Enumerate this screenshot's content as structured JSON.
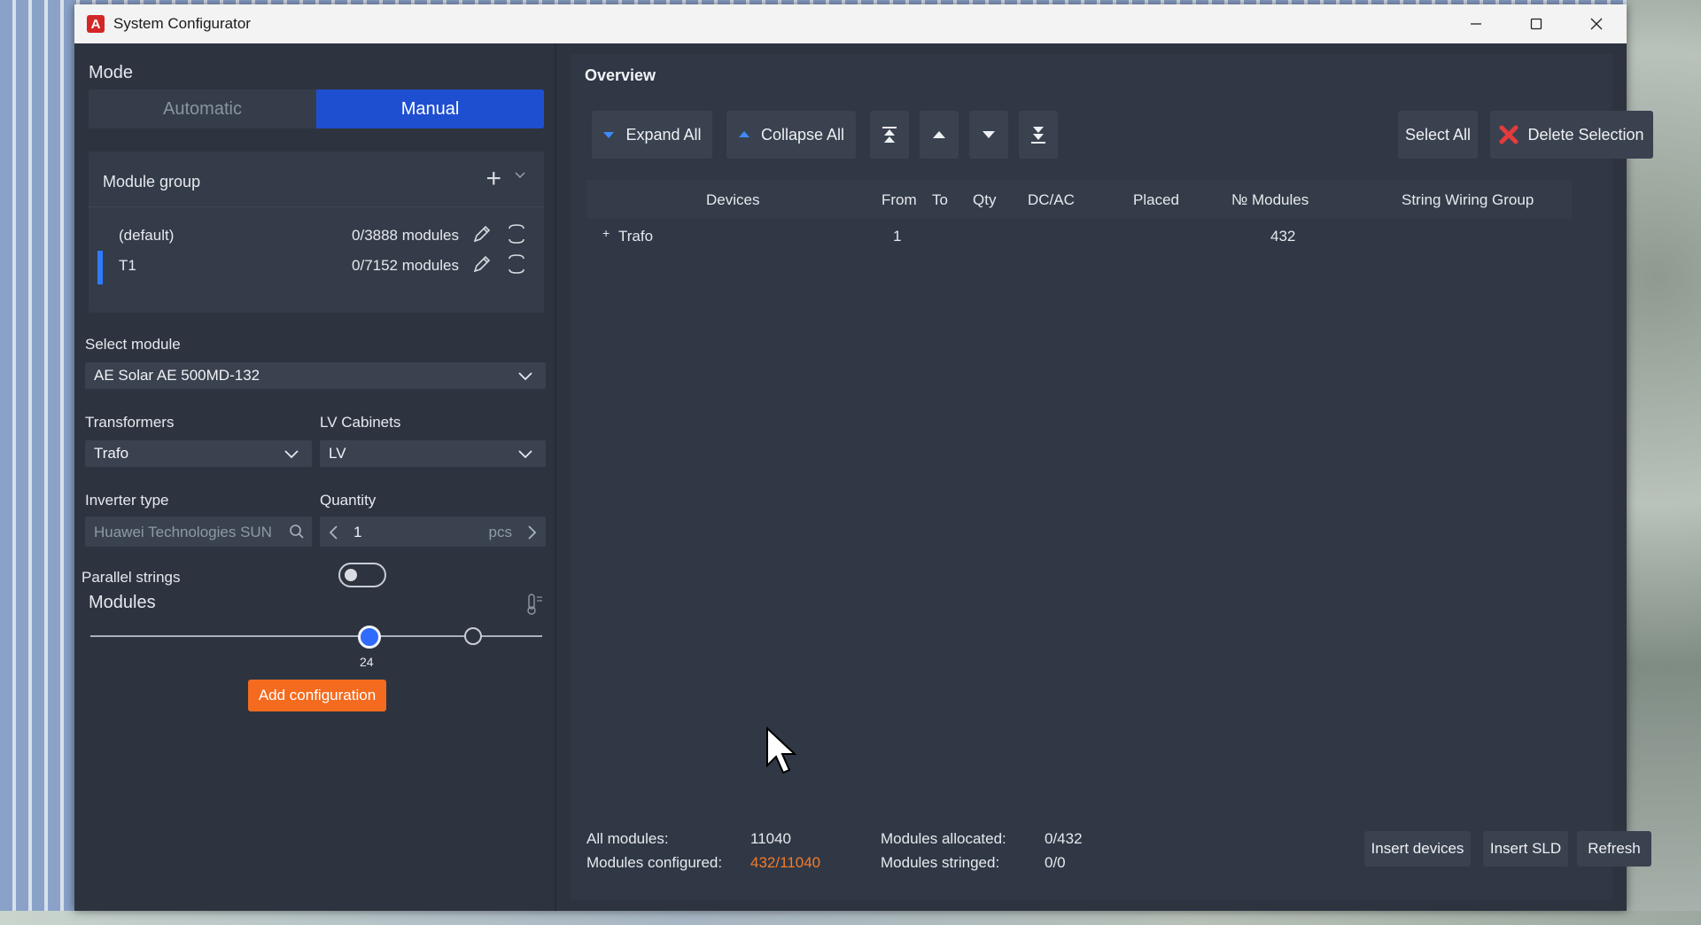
{
  "window": {
    "title": "System Configurator"
  },
  "mode": {
    "title": "Mode",
    "options": [
      "Automatic",
      "Manual"
    ],
    "selected": "Manual"
  },
  "module_group": {
    "title": "Module group",
    "rows": [
      {
        "name": "(default)",
        "count": "0/3888 modules"
      },
      {
        "name": "T1",
        "count": "0/7152 modules"
      }
    ]
  },
  "select_module": {
    "label": "Select module",
    "value": "AE Solar AE 500MD-132"
  },
  "transformers": {
    "label": "Transformers",
    "value": "Trafo"
  },
  "lv_cabinets": {
    "label": "LV Cabinets",
    "value": "LV"
  },
  "inverter_type": {
    "label": "Inverter type",
    "value": "Huawei Technologies SUN"
  },
  "quantity": {
    "label": "Quantity",
    "value": "1",
    "unit": "pcs"
  },
  "parallel_strings": {
    "label": "Parallel strings",
    "enabled": false
  },
  "modules": {
    "label": "Modules",
    "slider_value": "24"
  },
  "add_configuration": "Add configuration",
  "overview": {
    "title": "Overview",
    "toolbar": {
      "expand_all": "Expand All",
      "collapse_all": "Collapse All",
      "select_all": "Select All",
      "delete_selection": "Delete Selection"
    },
    "columns": [
      "Devices",
      "From",
      "To",
      "Qty",
      "DC/AC",
      "Placed",
      "№ Modules",
      "String Wiring Group"
    ],
    "rows": [
      {
        "expander": "+",
        "device": "Trafo",
        "from": "1",
        "modules": "432"
      }
    ],
    "summary": {
      "all_modules_label": "All modules:",
      "all_modules": "11040",
      "modules_configured_label": "Modules configured:",
      "modules_configured": "432/11040",
      "modules_allocated_label": "Modules allocated:",
      "modules_allocated": "0/432",
      "modules_stringed_label": "Modules stringed:",
      "modules_stringed": "0/0"
    },
    "actions": {
      "insert_devices": "Insert devices",
      "insert_sld": "Insert SLD",
      "refresh": "Refresh"
    }
  },
  "colors": {
    "accent": "#1f4fd1",
    "orange": "#f46b1f",
    "panel": "#2d3440"
  }
}
